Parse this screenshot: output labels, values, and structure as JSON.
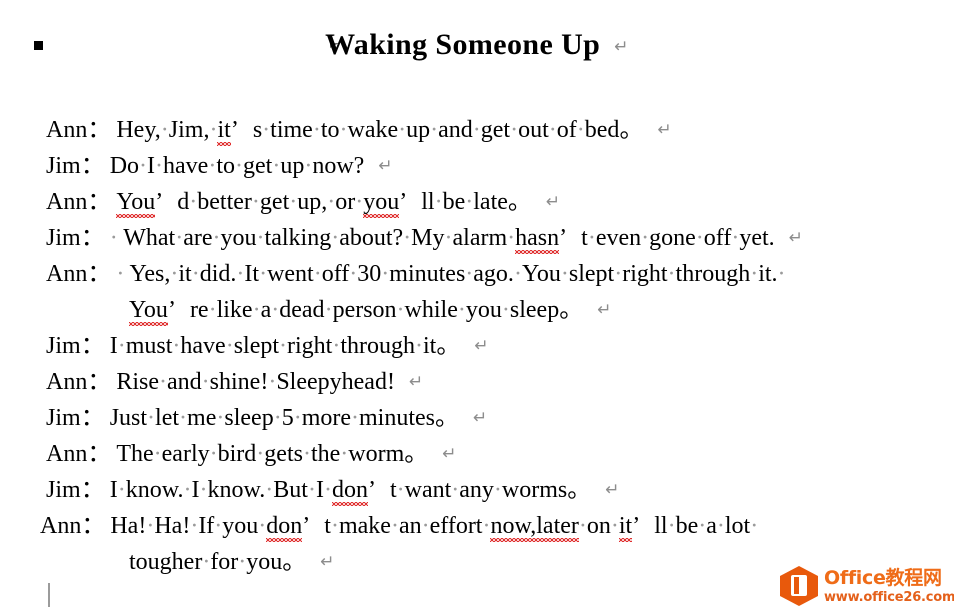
{
  "document": {
    "title": "Waking Someone Up",
    "title_outline_marker": "collapse-triangle-icon",
    "bullet_marker": "black-square-bullet",
    "paragraph_mark": "↵",
    "space_dot": "·",
    "apostrophe": "’",
    "ideographic_period": "。",
    "full_width_colon": "：",
    "caret_visible": true
  },
  "lines": [
    {
      "speaker": "Ann",
      "colon": "：",
      "lead_dot": false,
      "segments": [
        {
          "t": "Hey,"
        },
        {
          "sp": true
        },
        {
          "t": "Jim,"
        },
        {
          "sp": true
        },
        {
          "t": "it",
          "misspelled": true
        },
        {
          "apos": true
        },
        {
          "t": "s"
        },
        {
          "sp": true
        },
        {
          "t": "time"
        },
        {
          "sp": true
        },
        {
          "t": "to"
        },
        {
          "sp": true
        },
        {
          "t": "wake"
        },
        {
          "sp": true
        },
        {
          "t": "up"
        },
        {
          "sp": true
        },
        {
          "t": "and"
        },
        {
          "sp": true
        },
        {
          "t": "get"
        },
        {
          "sp": true
        },
        {
          "t": "out"
        },
        {
          "sp": true
        },
        {
          "t": "of"
        },
        {
          "sp": true
        },
        {
          "t": "bed"
        },
        {
          "ideo": true
        }
      ],
      "pilcrow": true
    },
    {
      "speaker": "Jim",
      "colon": "：",
      "lead_dot": false,
      "segments": [
        {
          "t": "Do"
        },
        {
          "sp": true
        },
        {
          "t": "I"
        },
        {
          "sp": true
        },
        {
          "t": "have"
        },
        {
          "sp": true
        },
        {
          "t": "to"
        },
        {
          "sp": true
        },
        {
          "t": "get"
        },
        {
          "sp": true
        },
        {
          "t": "up"
        },
        {
          "sp": true
        },
        {
          "t": "now?"
        }
      ],
      "pilcrow": true
    },
    {
      "speaker": "Ann",
      "colon": "：",
      "lead_dot": false,
      "segments": [
        {
          "t": "You",
          "misspelled": true
        },
        {
          "apos": true
        },
        {
          "t": "d"
        },
        {
          "sp": true
        },
        {
          "t": "better"
        },
        {
          "sp": true
        },
        {
          "t": "get"
        },
        {
          "sp": true
        },
        {
          "t": "up,"
        },
        {
          "sp": true
        },
        {
          "t": "or"
        },
        {
          "sp": true
        },
        {
          "t": "you",
          "misspelled": true
        },
        {
          "apos": true
        },
        {
          "t": "ll"
        },
        {
          "sp": true
        },
        {
          "t": "be"
        },
        {
          "sp": true
        },
        {
          "t": "late"
        },
        {
          "ideo": true
        }
      ],
      "pilcrow": true
    },
    {
      "speaker": "Jim",
      "colon": "：",
      "lead_dot": true,
      "segments": [
        {
          "t": "What"
        },
        {
          "sp": true
        },
        {
          "t": "are"
        },
        {
          "sp": true
        },
        {
          "t": "you"
        },
        {
          "sp": true
        },
        {
          "t": "talking"
        },
        {
          "sp": true
        },
        {
          "t": "about?"
        },
        {
          "sp": true
        },
        {
          "t": "My"
        },
        {
          "sp": true
        },
        {
          "t": "alarm"
        },
        {
          "sp": true
        },
        {
          "t": "hasn",
          "misspelled": true
        },
        {
          "apos": true
        },
        {
          "t": "t"
        },
        {
          "sp": true
        },
        {
          "t": "even"
        },
        {
          "sp": true
        },
        {
          "t": "gone"
        },
        {
          "sp": true
        },
        {
          "t": "off"
        },
        {
          "sp": true
        },
        {
          "t": "yet."
        }
      ],
      "pilcrow": true
    },
    {
      "speaker": "Ann",
      "colon": "：",
      "lead_dot": true,
      "segments": [
        {
          "t": "Yes,"
        },
        {
          "sp": true
        },
        {
          "t": "it"
        },
        {
          "sp": true
        },
        {
          "t": "did."
        },
        {
          "sp": true
        },
        {
          "t": "It"
        },
        {
          "sp": true
        },
        {
          "t": "went"
        },
        {
          "sp": true
        },
        {
          "t": "off"
        },
        {
          "sp": true
        },
        {
          "t": "30"
        },
        {
          "sp": true
        },
        {
          "t": "minutes"
        },
        {
          "sp": true
        },
        {
          "t": "ago."
        },
        {
          "sp": true
        },
        {
          "t": "You"
        },
        {
          "sp": true
        },
        {
          "t": "slept"
        },
        {
          "sp": true
        },
        {
          "t": "right"
        },
        {
          "sp": true
        },
        {
          "t": "through"
        },
        {
          "sp": true
        },
        {
          "t": "it."
        },
        {
          "sp": true
        }
      ],
      "pilcrow": false
    },
    {
      "continuation": true,
      "segments": [
        {
          "t": "You",
          "misspelled": true
        },
        {
          "apos": true
        },
        {
          "t": "re"
        },
        {
          "sp": true
        },
        {
          "t": "like"
        },
        {
          "sp": true
        },
        {
          "t": "a"
        },
        {
          "sp": true
        },
        {
          "t": "dead"
        },
        {
          "sp": true
        },
        {
          "t": "person"
        },
        {
          "sp": true
        },
        {
          "t": "while"
        },
        {
          "sp": true
        },
        {
          "t": "you"
        },
        {
          "sp": true
        },
        {
          "t": "sleep"
        },
        {
          "ideo": true
        }
      ],
      "pilcrow": true
    },
    {
      "speaker": "Jim",
      "colon": "：",
      "lead_dot": false,
      "segments": [
        {
          "t": "I"
        },
        {
          "sp": true
        },
        {
          "t": "must"
        },
        {
          "sp": true
        },
        {
          "t": "have"
        },
        {
          "sp": true
        },
        {
          "t": "slept"
        },
        {
          "sp": true
        },
        {
          "t": "right"
        },
        {
          "sp": true
        },
        {
          "t": "through"
        },
        {
          "sp": true
        },
        {
          "t": "it"
        },
        {
          "ideo": true
        }
      ],
      "pilcrow": true
    },
    {
      "speaker": "Ann",
      "colon": "：",
      "lead_dot": false,
      "segments": [
        {
          "t": "Rise"
        },
        {
          "sp": true
        },
        {
          "t": "and"
        },
        {
          "sp": true
        },
        {
          "t": "shine!"
        },
        {
          "sp": true
        },
        {
          "t": "Sleepyhead!"
        }
      ],
      "pilcrow": true
    },
    {
      "speaker": "Jim",
      "colon": "：",
      "lead_dot": false,
      "segments": [
        {
          "t": "Just"
        },
        {
          "sp": true
        },
        {
          "t": "let"
        },
        {
          "sp": true
        },
        {
          "t": "me"
        },
        {
          "sp": true
        },
        {
          "t": "sleep"
        },
        {
          "sp": true
        },
        {
          "t": "5"
        },
        {
          "sp": true
        },
        {
          "t": "more"
        },
        {
          "sp": true
        },
        {
          "t": "minutes"
        },
        {
          "ideo": true
        }
      ],
      "pilcrow": true
    },
    {
      "speaker": "Ann",
      "colon": "：",
      "lead_dot": false,
      "segments": [
        {
          "t": "The"
        },
        {
          "sp": true
        },
        {
          "t": "early"
        },
        {
          "sp": true
        },
        {
          "t": "bird"
        },
        {
          "sp": true
        },
        {
          "t": "gets"
        },
        {
          "sp": true
        },
        {
          "t": "the"
        },
        {
          "sp": true
        },
        {
          "t": "worm"
        },
        {
          "ideo": true
        }
      ],
      "pilcrow": true
    },
    {
      "speaker": "Jim",
      "colon": "：",
      "lead_dot": false,
      "segments": [
        {
          "t": "I"
        },
        {
          "sp": true
        },
        {
          "t": "know."
        },
        {
          "sp": true
        },
        {
          "t": "I"
        },
        {
          "sp": true
        },
        {
          "t": "know."
        },
        {
          "sp": true
        },
        {
          "t": "But"
        },
        {
          "sp": true
        },
        {
          "t": "I"
        },
        {
          "sp": true
        },
        {
          "t": "don",
          "misspelled": true
        },
        {
          "apos": true
        },
        {
          "t": "t"
        },
        {
          "sp": true
        },
        {
          "t": "want"
        },
        {
          "sp": true
        },
        {
          "t": "any"
        },
        {
          "sp": true
        },
        {
          "t": "worms"
        },
        {
          "ideo": true
        }
      ],
      "pilcrow": true
    },
    {
      "speaker": "Ann",
      "colon": "：",
      "lead_dot": false,
      "shift_left": true,
      "segments": [
        {
          "t": "Ha!"
        },
        {
          "sp": true
        },
        {
          "t": "Ha!"
        },
        {
          "sp": true
        },
        {
          "t": "If"
        },
        {
          "sp": true
        },
        {
          "t": "you"
        },
        {
          "sp": true
        },
        {
          "t": "don",
          "misspelled": true
        },
        {
          "apos": true
        },
        {
          "t": "t"
        },
        {
          "sp": true
        },
        {
          "t": "make"
        },
        {
          "sp": true
        },
        {
          "t": "an"
        },
        {
          "sp": true
        },
        {
          "t": "effort"
        },
        {
          "sp": true
        },
        {
          "t": "now,later",
          "misspelled": true
        },
        {
          "sp": true
        },
        {
          "t": "on"
        },
        {
          "sp": true
        },
        {
          "t": "it",
          "misspelled": true
        },
        {
          "apos": true
        },
        {
          "t": "ll"
        },
        {
          "sp": true
        },
        {
          "t": "be"
        },
        {
          "sp": true
        },
        {
          "t": "a"
        },
        {
          "sp": true
        },
        {
          "t": "lot"
        },
        {
          "sp": true
        }
      ],
      "pilcrow": false
    },
    {
      "continuation": true,
      "segments": [
        {
          "t": "tougher"
        },
        {
          "sp": true
        },
        {
          "t": "for"
        },
        {
          "sp": true
        },
        {
          "t": "you"
        },
        {
          "ideo": true
        }
      ],
      "pilcrow": true
    }
  ],
  "watermark": {
    "brand": "Office教程网",
    "url": "www.office26.com",
    "brand_color": "#ef6c18",
    "url_color": "#e4601a",
    "logo_color": "#e8590c",
    "logo_name": "office-hexagon-logo"
  }
}
